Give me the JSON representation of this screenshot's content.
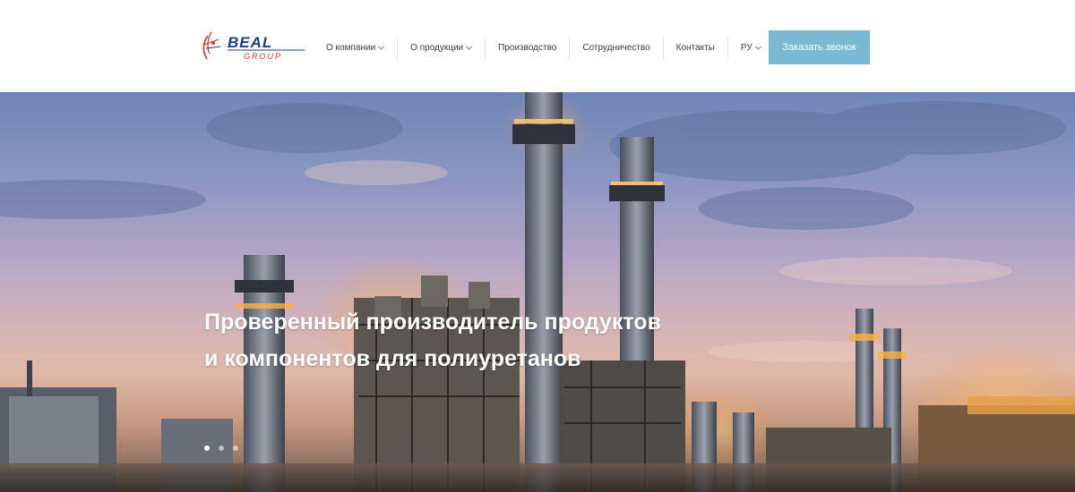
{
  "brand": {
    "logo_main": "BEAL",
    "logo_sub": "GROUP",
    "colors": {
      "logo_blue": "#1b3f8e",
      "logo_red": "#d8342a",
      "cta_bg": "#7ab8d3"
    }
  },
  "nav": {
    "items": [
      {
        "label": "О компании",
        "has_dropdown": true
      },
      {
        "label": "О продукции",
        "has_dropdown": true
      },
      {
        "label": "Производство",
        "has_dropdown": false
      },
      {
        "label": "Сотрудничество",
        "has_dropdown": false
      },
      {
        "label": "Контакты",
        "has_dropdown": false
      }
    ],
    "language": {
      "label": "РУ",
      "has_dropdown": true
    },
    "cta_label": "Заказать звонок"
  },
  "slider_progress": 0.2,
  "hero": {
    "title_line1": "Проверенный производитель продуктов",
    "title_line2": "и компонентов для полиуретанов",
    "slide_count": 3,
    "active_slide": 1
  }
}
